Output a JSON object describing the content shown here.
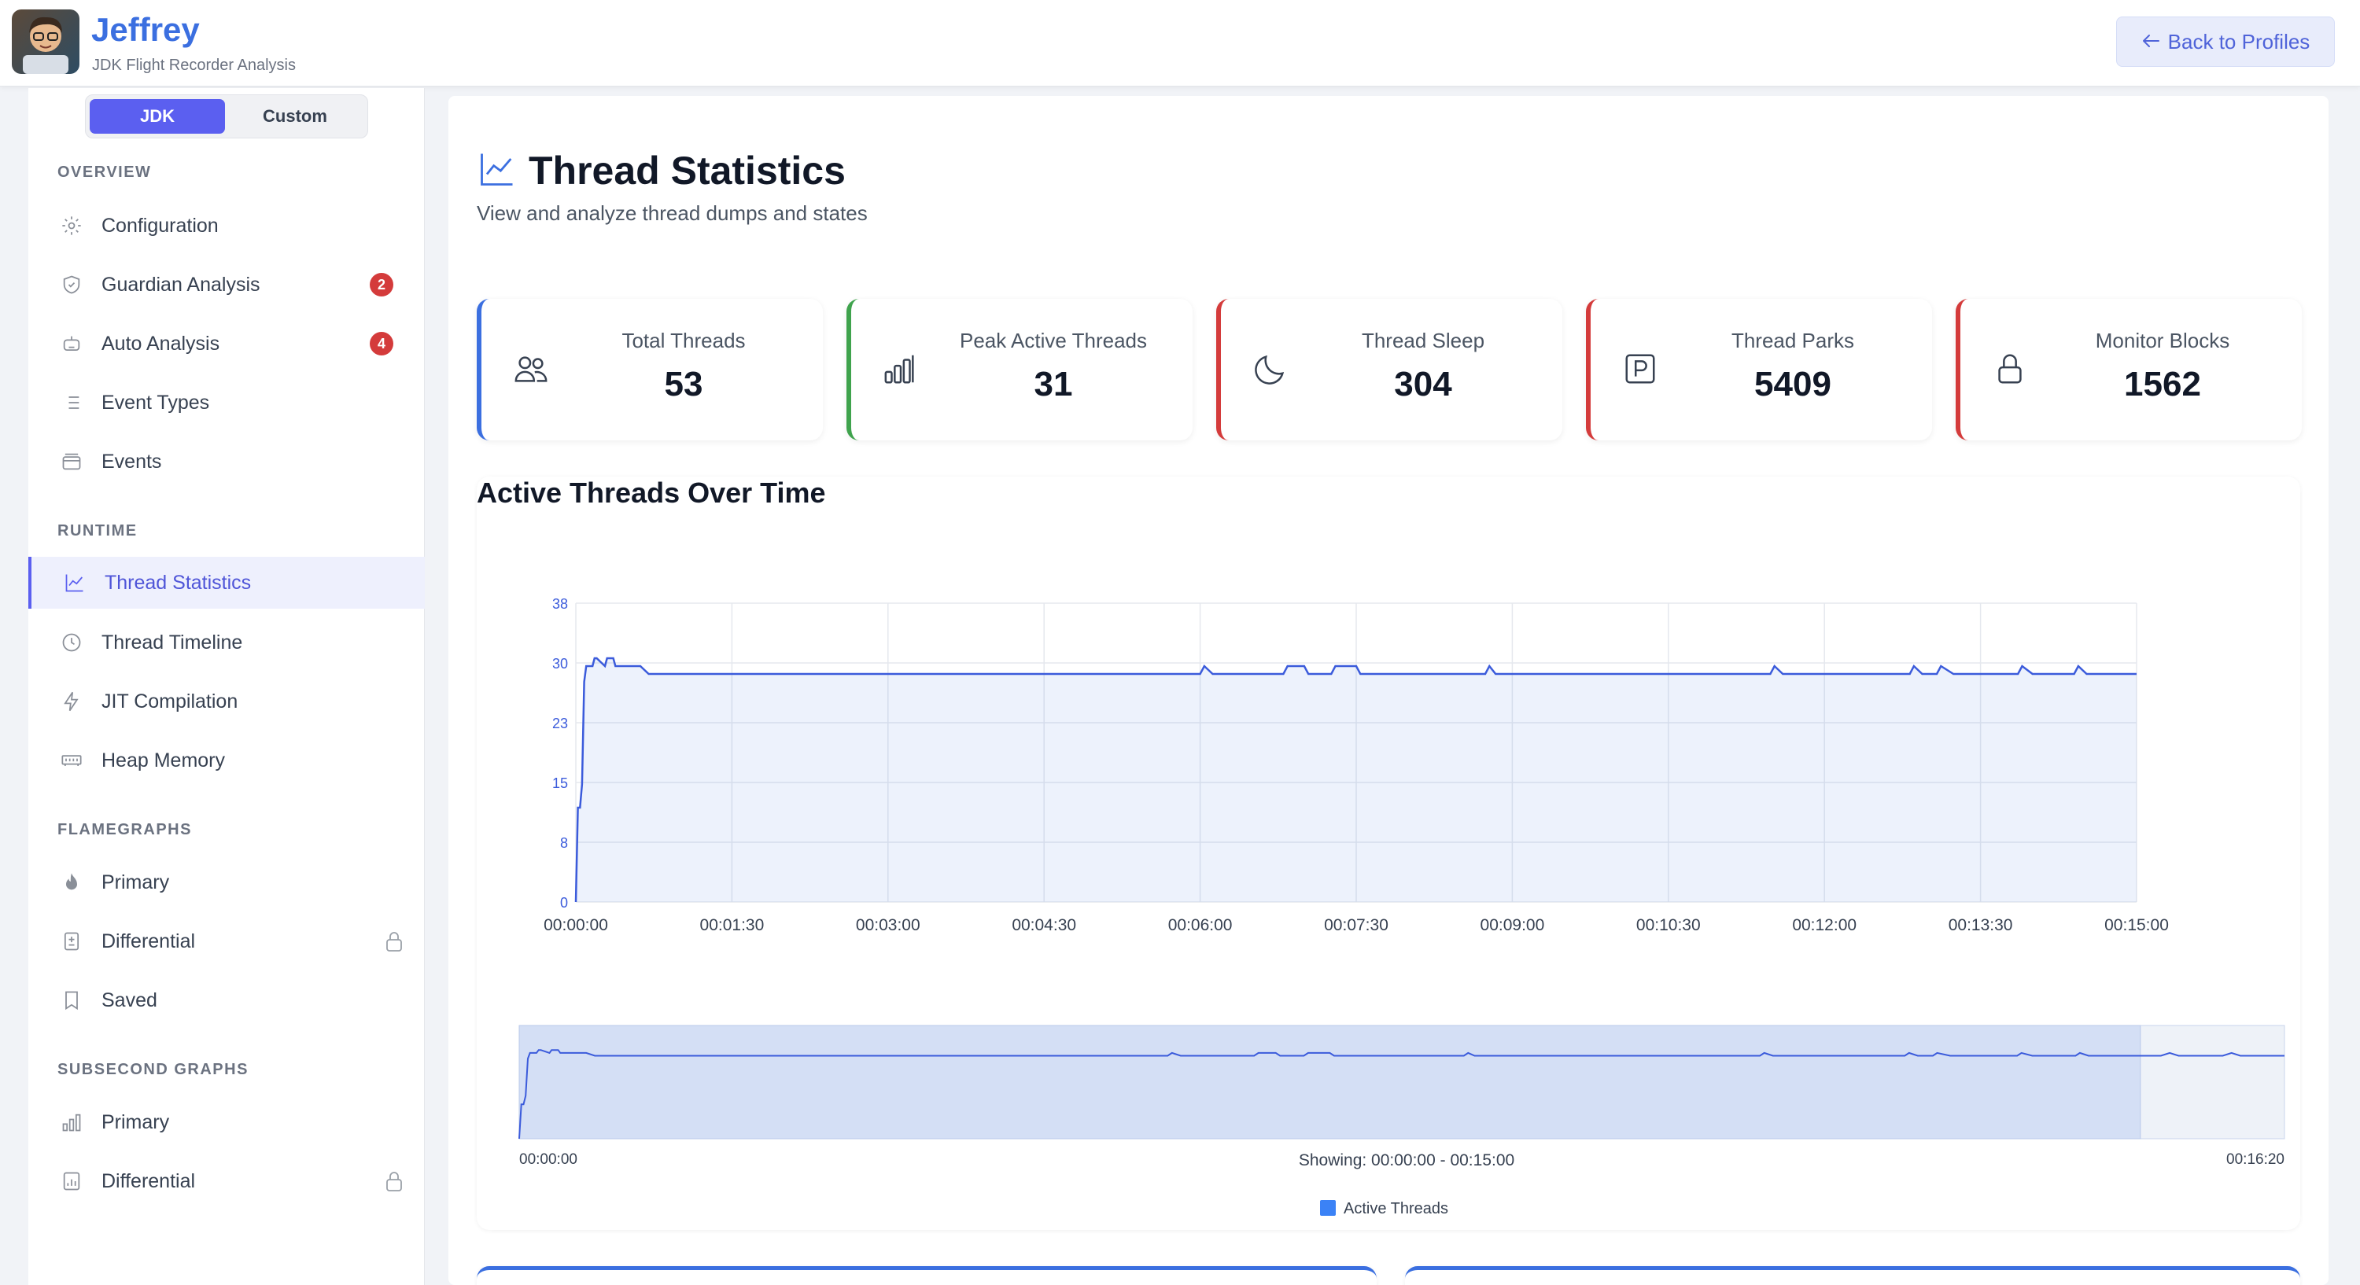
{
  "app": {
    "title": "Jeffrey",
    "subtitle": "JDK Flight Recorder Analysis",
    "back_label": "Back to Profiles",
    "accent": "#5b5ff0"
  },
  "sidebar": {
    "toggle": {
      "active": "JDK",
      "inactive": "Custom"
    },
    "sections": {
      "overview": "OVERVIEW",
      "runtime": "RUNTIME",
      "flamegraphs": "FLAMEGRAPHS",
      "subsecond": "SUBSECOND GRAPHS"
    },
    "items": {
      "configuration": "Configuration",
      "guardian": "Guardian Analysis",
      "guardian_badge": "2",
      "auto": "Auto Analysis",
      "auto_badge": "4",
      "event_types": "Event Types",
      "events": "Events",
      "thread_statistics": "Thread Statistics",
      "thread_timeline": "Thread Timeline",
      "jit": "JIT Compilation",
      "heap": "Heap Memory",
      "flame_primary": "Primary",
      "flame_differential": "Differential",
      "flame_saved": "Saved",
      "sub_primary": "Primary",
      "sub_differential": "Differential"
    }
  },
  "main": {
    "title": "Thread Statistics",
    "subtitle": "View and analyze thread dumps and states",
    "stats": [
      {
        "label": "Total Threads",
        "value": "53",
        "color": "#3b6fe0",
        "icon": "users-icon"
      },
      {
        "label": "Peak Active Threads",
        "value": "31",
        "color": "#3fa34d",
        "icon": "bar-chart-icon"
      },
      {
        "label": "Thread Sleep",
        "value": "304",
        "color": "#d43b3b",
        "icon": "moon-icon"
      },
      {
        "label": "Thread Parks",
        "value": "5409",
        "color": "#d43b3b",
        "icon": "parking-icon"
      },
      {
        "label": "Monitor Blocks",
        "value": "1562",
        "color": "#d43b3b",
        "icon": "lock-icon"
      }
    ]
  },
  "chart_data": {
    "type": "area",
    "title": "Active Threads Over Time",
    "ylim": [
      0,
      38
    ],
    "yticks": [
      "0",
      "8",
      "15",
      "23",
      "30",
      "38"
    ],
    "xticks": [
      "00:00:00",
      "00:01:30",
      "00:03:00",
      "00:04:30",
      "00:06:00",
      "00:07:30",
      "00:09:00",
      "00:10:30",
      "00:12:00",
      "00:13:30",
      "00:15:00"
    ],
    "grid": true,
    "legend_position": "bottom",
    "series": [
      {
        "name": "Active Threads",
        "color": "#3b6fe0",
        "x": [
          0,
          2,
          4,
          6,
          8,
          10,
          12,
          14,
          16,
          18,
          20,
          28,
          30,
          36,
          38,
          60,
          62,
          70,
          72,
          600,
          604,
          612,
          680,
          684,
          700,
          704,
          726,
          730,
          750,
          754,
          874,
          878,
          884,
          1148,
          1152,
          1160,
          1282,
          1286,
          1294,
          1308,
          1312,
          1324,
          1386,
          1390,
          1400,
          1440,
          1444,
          1452,
          1500
        ],
        "y": [
          0,
          12,
          12,
          15,
          28,
          30,
          30,
          30,
          30,
          31,
          31,
          30,
          31,
          31,
          30,
          30,
          30,
          29,
          29,
          29,
          30,
          29,
          29,
          30,
          30,
          29,
          29,
          30,
          30,
          29,
          29,
          30,
          29,
          29,
          30,
          29,
          29,
          30,
          29,
          29,
          30,
          29,
          29,
          30,
          29,
          29,
          30,
          29,
          29
        ]
      }
    ],
    "navigator": {
      "start_label": "00:00:00",
      "end_label": "00:16:20",
      "range_label": "Showing: 00:00:00 - 00:15:00",
      "total_seconds": 980,
      "window_start": 0,
      "window_end": 900
    }
  }
}
